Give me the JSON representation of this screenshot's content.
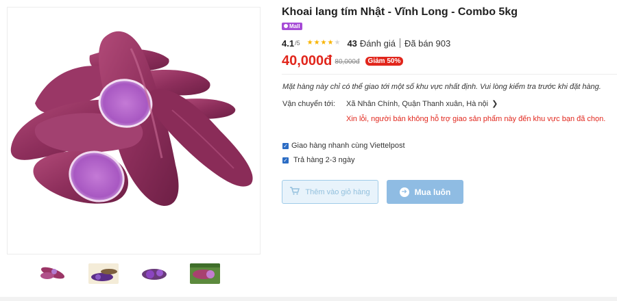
{
  "product": {
    "title": "Khoai lang tím Nhật - Vĩnh Long - Combo 5kg",
    "badge": "Mall",
    "image_alt": "purple sweet potatoes",
    "thumbnails": [
      "thumb-1",
      "thumb-2",
      "thumb-3",
      "thumb-4"
    ]
  },
  "rating": {
    "score": "4.1",
    "max": "/5",
    "stars_filled": 4,
    "reviews_count": "43",
    "reviews_label": "Đánh giá",
    "sold": "Đã bán 903"
  },
  "price": {
    "current": "40,000đ",
    "original": "80,000đ",
    "discount": "Giảm 50%"
  },
  "shipping": {
    "notice": "Mặt hàng này chỉ có thể giao tới một số khu vực nhất định. Vui lòng kiểm tra trước khi đặt hàng.",
    "label": "Vận chuyển tới:",
    "address": "Xã Nhân Chính, Quận Thanh xuân, Hà nội",
    "error": "Xin lỗi, người bán không hỗ trợ giao sản phẩm này đến khu vực bạn đã chọn."
  },
  "options": [
    {
      "label": "Giao hàng nhanh cùng Viettelpost",
      "checked": true
    },
    {
      "label": "Trả hàng 2-3 ngày",
      "checked": true
    }
  ],
  "actions": {
    "add_to_cart": "Thêm vào giỏ hàng",
    "buy_now": "Mua luôn"
  },
  "colors": {
    "price": "#e1261c",
    "mall": "#a64bd6",
    "buy_button": "#8fbce3",
    "checkbox": "#2b6cc4"
  }
}
